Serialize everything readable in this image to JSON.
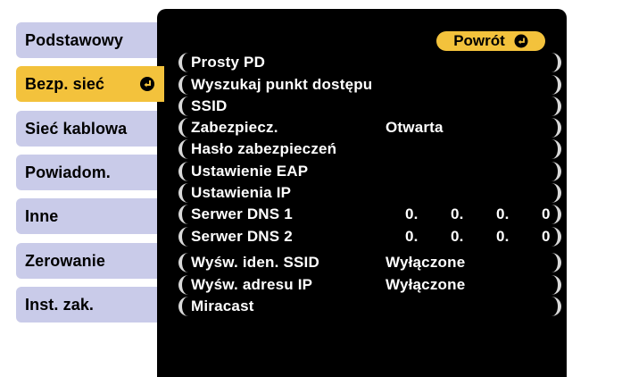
{
  "tabs": [
    {
      "label": "Podstawowy",
      "active": false
    },
    {
      "label": "Bezp. sieć",
      "active": true
    },
    {
      "label": "Sieć kablowa",
      "active": false
    },
    {
      "label": "Powiadom.",
      "active": false
    },
    {
      "label": "Inne",
      "active": false
    },
    {
      "label": "Zerowanie",
      "active": false
    },
    {
      "label": "Inst. zak.",
      "active": false
    }
  ],
  "return_button": {
    "label": "Powrót",
    "icon": "enter-icon"
  },
  "menu": [
    {
      "label": "Prosty PD",
      "value": ""
    },
    {
      "label": "Wyszukaj punkt dostępu",
      "value": ""
    },
    {
      "label": "SSID",
      "value": ""
    },
    {
      "label": "Zabezpiecz.",
      "value": "Otwarta"
    },
    {
      "label": "Hasło zabezpieczeń",
      "value": ""
    },
    {
      "label": "Ustawienie EAP",
      "value": ""
    },
    {
      "label": "Ustawienia IP",
      "value": ""
    },
    {
      "label": "Serwer DNS 1",
      "ip": [
        "0.",
        "0.",
        "0.",
        "0"
      ]
    },
    {
      "label": "Serwer DNS 2",
      "ip": [
        "0.",
        "0.",
        "0.",
        "0"
      ]
    },
    {
      "label": "Wyśw. iden. SSID",
      "value": "Wyłączone"
    },
    {
      "label": "Wyśw. adresu IP",
      "value": "Wyłączone"
    },
    {
      "label": "Miracast",
      "value": ""
    }
  ],
  "colors": {
    "tab_inactive": "#c9cbe9",
    "tab_active": "#f3c23c",
    "panel_bg": "#000000",
    "row_edge": "#d8d8d8",
    "text_light": "#ffffff"
  }
}
